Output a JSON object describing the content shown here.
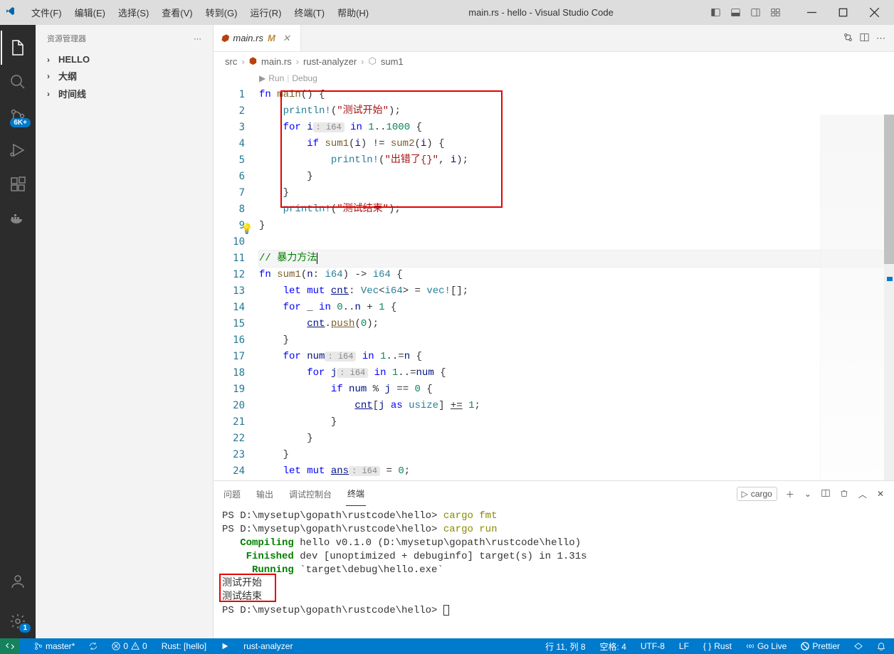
{
  "title": "main.rs - hello - Visual Studio Code",
  "menu": [
    "文件(F)",
    "编辑(E)",
    "选择(S)",
    "查看(V)",
    "转到(G)",
    "运行(R)",
    "终端(T)",
    "帮助(H)"
  ],
  "activity_badge": "6K+",
  "settings_badge": "1",
  "sidebar": {
    "title": "资源管理器",
    "items": [
      "HELLO",
      "大纲",
      "时间线"
    ]
  },
  "tab": {
    "name": "main.rs",
    "modified": "M"
  },
  "breadcrumb": [
    "src",
    "main.rs",
    "rust-analyzer",
    "sum1"
  ],
  "codelens": {
    "run": "Run",
    "debug": "Debug"
  },
  "code": {
    "l1": "fn main() {",
    "l2": "    println!(\"测试开始\");",
    "l3": "    for i: i64 in 1..1000 {",
    "l4": "        if sum1(i) != sum2(i) {",
    "l5": "            println!(\"出错了{}\", i);",
    "l6": "        }",
    "l7": "    }",
    "l8": "    println!(\"测试结束\");",
    "l9": "}",
    "l10": "",
    "l11": "// 暴力方法",
    "l12": "fn sum1(n: i64) -> i64 {",
    "l13": "    let mut cnt: Vec<i64> = vec![];",
    "l14": "    for _ in 0..n + 1 {",
    "l15": "        cnt.push(0);",
    "l16": "    }",
    "l17": "    for num: i64 in 1..=n {",
    "l18": "        for j: i64 in 1..=num {",
    "l19": "            if num % j == 0 {",
    "l20": "                cnt[j as usize] += 1;",
    "l21": "            }",
    "l22": "        }",
    "l23": "    }",
    "l24": "    let mut ans: i64 = 0;"
  },
  "panel": {
    "tabs": [
      "问题",
      "输出",
      "调试控制台",
      "终端"
    ],
    "active_tab": 3,
    "launcher": "cargo"
  },
  "terminal": {
    "prompt1": "PS D:\\mysetup\\gopath\\rustcode\\hello> ",
    "cmd1": "cargo fmt",
    "cmd2": "cargo run",
    "line_compiling_a": "   Compiling",
    "line_compiling_b": " hello v0.1.0 (D:\\mysetup\\gopath\\rustcode\\hello)",
    "line_finished_a": "    Finished",
    "line_finished_b": " dev [unoptimized + debuginfo] target(s) in 1.31s",
    "line_running_a": "     Running",
    "line_running_b": " `target\\debug\\hello.exe`",
    "out1": "测试开始",
    "out2": "测试结束"
  },
  "status": {
    "branch": "master*",
    "sync": "",
    "errors": "0",
    "warnings": "0",
    "rust_project": "Rust: [hello]",
    "lsp": "rust-analyzer",
    "cursor": "行 11, 列 8",
    "spaces": "空格: 4",
    "encoding": "UTF-8",
    "eol": "LF",
    "lang": "Rust",
    "golive": "Go Live",
    "prettier": "Prettier"
  }
}
